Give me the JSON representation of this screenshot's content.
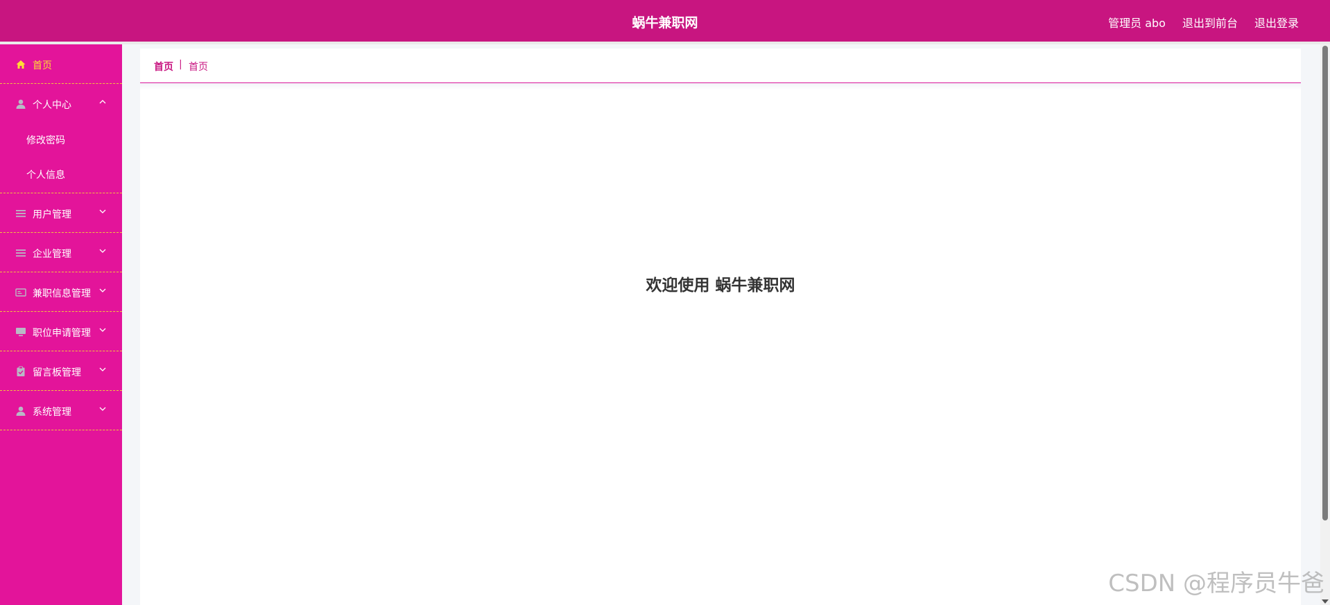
{
  "header": {
    "site_title": "蜗牛兼职网",
    "admin_label": "管理员 abo",
    "exit_front": "退出到前台",
    "logout": "退出登录"
  },
  "sidebar": {
    "items": [
      {
        "label": "首页",
        "icon": "home-icon",
        "active": true
      },
      {
        "label": "个人中心",
        "icon": "user-icon",
        "expanded": true,
        "children": [
          {
            "label": "修改密码"
          },
          {
            "label": "个人信息"
          }
        ]
      },
      {
        "label": "用户管理",
        "icon": "list-icon"
      },
      {
        "label": "企业管理",
        "icon": "list-icon"
      },
      {
        "label": "兼职信息管理",
        "icon": "card-icon"
      },
      {
        "label": "职位申请管理",
        "icon": "monitor-icon"
      },
      {
        "label": "留言板管理",
        "icon": "clipboard-icon"
      },
      {
        "label": "系统管理",
        "icon": "user-icon"
      }
    ]
  },
  "breadcrumb": {
    "home": "首页",
    "separator": "|",
    "current": "首页"
  },
  "main": {
    "welcome": "欢迎使用 蜗牛兼职网"
  },
  "watermark": "CSDN @程序员牛爸",
  "colors": {
    "topbar": "#c81580",
    "sidebar": "#e3149a",
    "active_text": "#ffdd33",
    "divider": "#f3c53d"
  }
}
